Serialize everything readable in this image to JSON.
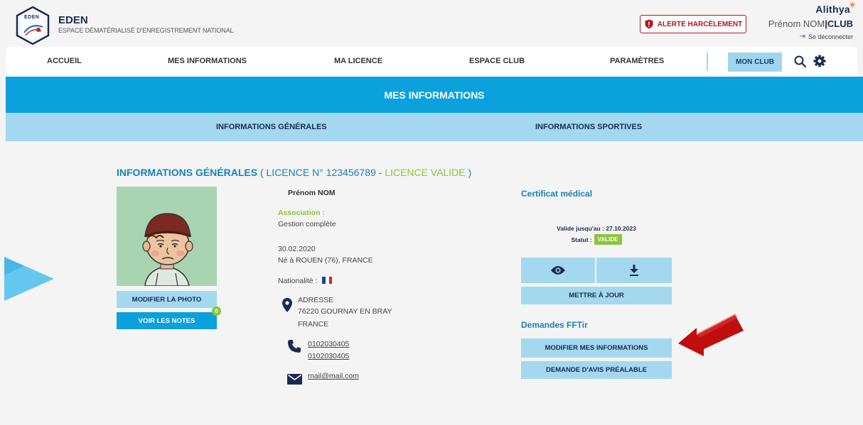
{
  "header": {
    "brand_name": "EDEN",
    "brand_sub": "ESPACE DÉMATÉRIALISÉ D'ENREGISTREMENT NATIONAL",
    "logo_text": "EDEN",
    "alert_label": "ALERTE HARCÈLEMENT",
    "company": "Alithya",
    "user_first": "Prénom NOM",
    "user_sep": "|",
    "user_role": "CLUB",
    "logout_label": "Se déconnecter"
  },
  "nav": {
    "items": [
      "ACCUEIL",
      "MES INFORMATIONS",
      "MA LICENCE",
      "ESPACE CLUB",
      "PARAMÈTRES"
    ],
    "club_button": "MON CLUB"
  },
  "banner": {
    "title": "MES INFORMATIONS"
  },
  "subnav": {
    "items": [
      "INFORMATIONS GÉNÉRALES",
      "INFORMATIONS SPORTIVES"
    ]
  },
  "section": {
    "title_main": "INFORMATIONS GÉNÉRALES",
    "title_open": " ( LICENCE N° 123456789 - ",
    "title_valid": "LICENCE VALIDE",
    "title_close": " )"
  },
  "photo_actions": {
    "modify_photo": "MODIFIER LA PHOTO",
    "view_notes": "VOIR LES NOTES",
    "notes_count": "0"
  },
  "person": {
    "name": "Prénom NOM",
    "association_label": "Association :",
    "association_value": "Gestion complète",
    "birth_date": "30.02.2020",
    "birth_place": "Né à  ROUEN (76), FRANCE",
    "nationality_label": "Nationalité :",
    "address_line1": "ADRESSE",
    "address_line2": "76220 GOURNAY EN BRAY",
    "address_line3": "FRANCE",
    "phone1": "0102030405",
    "phone2": "0102030405",
    "email": "mail@mail.com"
  },
  "certificate": {
    "title": "Certificat médical",
    "valid_until": "Valide jusqu'au : 27.10.2023",
    "status_label": "Statut :",
    "status_value": "VALIDE",
    "update_button": "METTRE À JOUR"
  },
  "fftir": {
    "title": "Demandes FFTir",
    "modify_button": "MODIFIER MES INFORMATIONS",
    "request_button": "DEMANDE D'AVIS PRÉALABLE"
  },
  "colors": {
    "primary": "#0aa1dd",
    "light_blue": "#a3d8ef",
    "green": "#8cc43c",
    "alert_red": "#b3151f",
    "arrow_red": "#c00d0d"
  }
}
